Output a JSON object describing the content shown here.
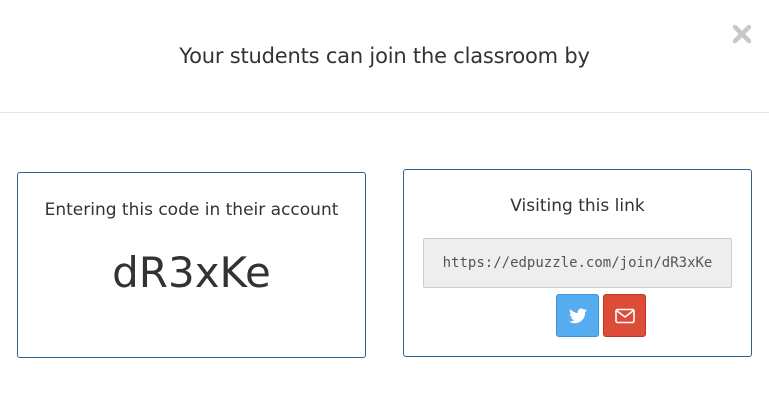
{
  "modal": {
    "title": "Your students can join the classroom by",
    "close_icon": "close-icon"
  },
  "code_panel": {
    "heading": "Entering this code in their account",
    "code": "dR3xKe"
  },
  "link_panel": {
    "heading": "Visiting this link",
    "link": "https://edpuzzle.com/join/dR3xKe",
    "share_buttons": [
      {
        "name": "twitter",
        "icon": "twitter-icon",
        "color": "#55acee"
      },
      {
        "name": "email",
        "icon": "envelope-icon",
        "color": "#dd4b39"
      }
    ]
  },
  "colors": {
    "panel_border": "#2a6496",
    "twitter": "#55acee",
    "email": "#dd4b39"
  }
}
